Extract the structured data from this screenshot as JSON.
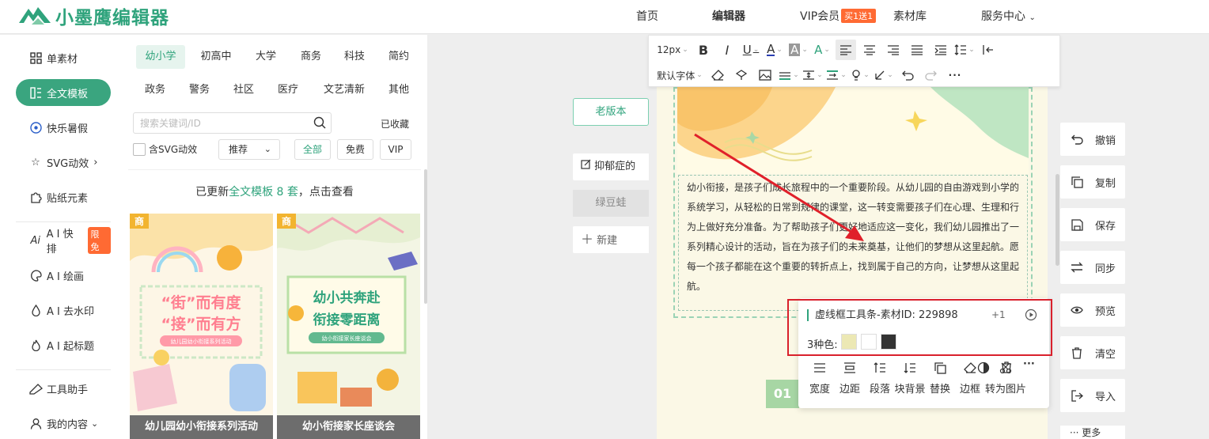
{
  "header": {
    "logo_text": "小墨鹰编辑器",
    "nav": [
      "首页",
      "编辑器",
      "VIP会员",
      "素材库",
      "服务中心"
    ],
    "vip_badge": "买1送1"
  },
  "sidebar": {
    "items": [
      {
        "label": "单素材",
        "icon": "grid-icon"
      },
      {
        "label": "全文模板",
        "icon": "template-icon"
      },
      {
        "label": "快乐暑假",
        "icon": "ball-icon"
      },
      {
        "label": "SVG动效",
        "icon": "star-icon"
      },
      {
        "label": "贴纸元素",
        "icon": "puzzle-icon"
      },
      {
        "label": "A I 快排",
        "icon": "ai-icon",
        "badge": "限免"
      },
      {
        "label": "A I 绘画",
        "icon": "palette-icon"
      },
      {
        "label": "A I 去水印",
        "icon": "drop-icon"
      },
      {
        "label": "A I 起标题",
        "icon": "flame-icon"
      },
      {
        "label": "工具助手",
        "icon": "ruler-icon"
      },
      {
        "label": "我的内容",
        "icon": "user-icon"
      }
    ]
  },
  "panel": {
    "categories_row1": [
      "幼小学",
      "初高中",
      "大学",
      "商务",
      "科技",
      "简约"
    ],
    "categories_row2": [
      "政务",
      "警务",
      "社区",
      "医疗",
      "文艺清新",
      "其他"
    ],
    "search_placeholder": "搜索关键词/ID",
    "favorites": "已收藏",
    "svg_checkbox": "含SVG动效",
    "sort": "推荐",
    "filters": [
      "全部",
      "免费",
      "VIP"
    ],
    "update_prefix": "已更新",
    "update_highlight": "全文模板 8 套",
    "update_suffix": "，点击查看",
    "cards": [
      {
        "tag": "商",
        "title": "幼儿园幼小衔接系列活动",
        "art_line1": "“街”而有度",
        "art_line2": "“接”而有方",
        "art_sub": "幼儿园幼小衔接系列活动"
      },
      {
        "tag": "商",
        "title": "幼小衔接家长座谈会",
        "art_line1": "幼小共奔赴",
        "art_line2": "衔接零距离",
        "art_sub": "幼小衔接家长座谈会"
      }
    ]
  },
  "middle": {
    "version_button": "老版本",
    "docs": [
      "抑郁症的",
      "绿豆蛙"
    ],
    "new_button": "新建"
  },
  "toolbar": {
    "font_size": "12px",
    "font_family": "默认字体"
  },
  "editor": {
    "paragraph": "幼小衔接，是孩子们成长旅程中的一个重要阶段。从幼儿园的自由游戏到小学的系统学习，从轻松的日常到规律的课堂，这一转变需要孩子们在心理、生理和行为上做好充分准备。为了帮助孩子们更好地适应这一变化，我们幼儿园推出了一系列精心设计的活动，旨在为孩子们的未来奠基，让他们的梦想从这里起航。愿每一个孩子都能在这个重要的转折点上，找到属于自己的方向，让梦想从这里起航。",
    "section_number": "01"
  },
  "popup": {
    "title": "虚线框工具条-素材ID: 229898",
    "plus": "+1",
    "colors_label": "3种色:",
    "colors": [
      "#ece8b4",
      "#ffffff",
      "#333333"
    ],
    "tools": [
      "宽度",
      "边距",
      "段落",
      "块背景",
      "替换",
      "边框",
      "转为图片"
    ]
  },
  "actions": [
    "撤销",
    "复制",
    "保存",
    "同步",
    "预览",
    "清空",
    "导入",
    "更多"
  ],
  "colors": {
    "accent": "#2fa37c",
    "red_annotation": "#d9212c",
    "badge": "#ff6a33"
  }
}
